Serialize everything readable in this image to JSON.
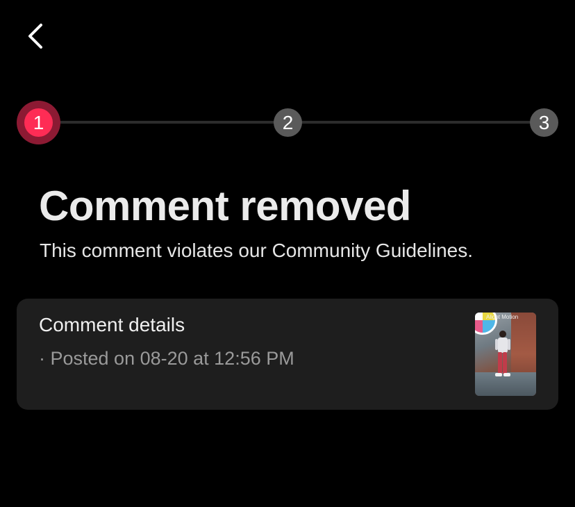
{
  "nav": {
    "back_icon": "chevron-left-icon"
  },
  "stepper": {
    "steps": [
      {
        "label": "1",
        "state": "active",
        "color": "#fe2c55"
      },
      {
        "label": "2",
        "state": "inactive",
        "color": "#5a5a5a"
      },
      {
        "label": "3",
        "state": "inactive",
        "color": "#5a5a5a"
      }
    ]
  },
  "header": {
    "title": "Comment removed",
    "subtitle": "This comment violates our Community Guidelines."
  },
  "details_card": {
    "title": "Comment details",
    "meta": "· Posted on 08-20 at 12:56 PM",
    "thumbnail": {
      "watermark": "Alight Motion"
    }
  },
  "colors": {
    "background": "#000000",
    "card": "#1e1e1e",
    "accent": "#fe2c55",
    "step_inactive": "#5a5a5a"
  }
}
